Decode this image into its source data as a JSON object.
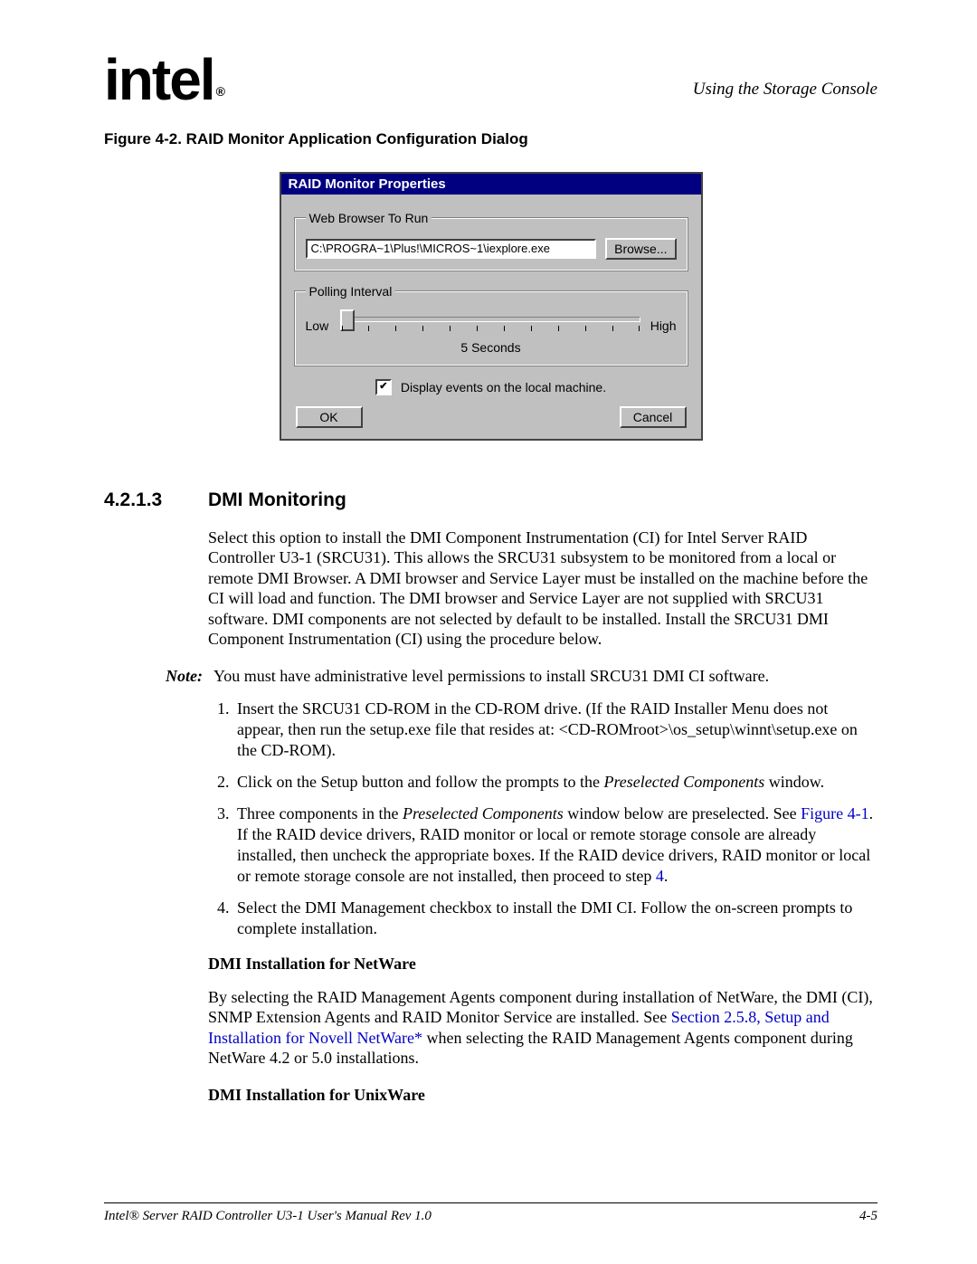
{
  "header": {
    "logo_text": "intel",
    "logo_reg": "®",
    "right": "Using the Storage Console"
  },
  "figure_caption": "Figure 4-2. RAID Monitor Application Configuration Dialog",
  "dialog": {
    "title": "RAID Monitor Properties",
    "group_browser": "Web Browser To Run",
    "browser_path": "C:\\PROGRA~1\\Plus!\\MICROS~1\\iexplore.exe",
    "browse_btn": "Browse...",
    "group_polling": "Polling Interval",
    "low": "Low",
    "high": "High",
    "seconds": "5 Seconds",
    "checkbox_label": "Display events on the local machine.",
    "ok": "OK",
    "cancel": "Cancel"
  },
  "section": {
    "num": "4.2.1.3",
    "title": "DMI Monitoring"
  },
  "para1": "Select this option to install the DMI Component Instrumentation (CI) for Intel Server RAID Controller U3-1 (SRCU31). This allows the SRCU31 subsystem to be monitored from a local or remote DMI Browser. A DMI browser and Service Layer must be installed on the machine before the CI will load and function. The DMI browser and Service Layer are not supplied with SRCU31 software. DMI components are not selected by default to be installed. Install the SRCU31 DMI Component Instrumentation (CI) using the procedure below.",
  "note_label": "Note:",
  "note_text": "You must have administrative level permissions to install SRCU31 DMI CI software.",
  "steps": {
    "s1": "Insert the SRCU31 CD-ROM in the CD-ROM drive. (If the RAID Installer Menu does not appear, then run the setup.exe file that resides at: <CD-ROMroot>\\os_setup\\winnt\\setup.exe on the CD-ROM).",
    "s2a": "Click on the Setup button and follow the prompts to the ",
    "s2b": "Preselected Components",
    "s2c": " window.",
    "s3a": "Three components in the ",
    "s3b": "Preselected Components",
    "s3c": " window below are preselected. See ",
    "s3link1": "Figure 4-1",
    "s3d": ". If the RAID device drivers, RAID monitor or local or remote storage console are already installed, then uncheck the appropriate boxes. If the RAID device drivers, RAID monitor or local or remote storage console are not installed, then proceed to step ",
    "s3link2": "4",
    "s3e": ".",
    "s4": "Select the DMI Management checkbox to install the DMI CI. Follow the on-screen prompts to complete installation."
  },
  "sub_netware_h": "DMI Installation for NetWare",
  "netware_a": "By selecting the RAID Management Agents component during installation of NetWare, the DMI (CI), SNMP Extension Agents and RAID Monitor Service are installed. See ",
  "netware_link": "Section 2.5.8, Setup and Installation for Novell NetWare*",
  "netware_b": " when selecting the RAID Management Agents component during NetWare 4.2 or 5.0 installations.",
  "sub_unixware_h": "DMI Installation for UnixWare",
  "footer": {
    "left": "Intel® Server RAID Controller U3-1 User's Manual Rev 1.0",
    "right": "4-5"
  }
}
